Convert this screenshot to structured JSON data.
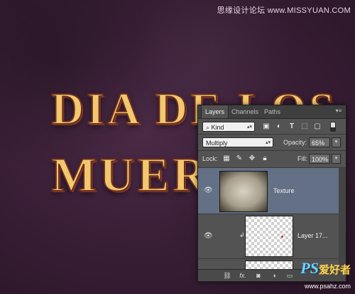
{
  "watermark_top": "思缘设计论坛 www.MISSYUAN.COM",
  "artwork": {
    "line1": "DIA DE LOS",
    "line2": "MUER"
  },
  "panel": {
    "tabs": [
      {
        "label": "Layers",
        "active": true
      },
      {
        "label": "Channels",
        "active": false
      },
      {
        "label": "Paths",
        "active": false
      }
    ],
    "filter": {
      "kind_label": "Kind"
    },
    "blend": {
      "mode": "Multiply",
      "opacity_label": "Opacity:",
      "opacity_value": "65%"
    },
    "lock": {
      "lock_label": "Lock:",
      "fill_label": "Fill:",
      "fill_value": "100%"
    },
    "layers": [
      {
        "name": "Texture",
        "selected": true,
        "visible": true
      },
      {
        "name": "Layer 17...",
        "selected": false,
        "visible": true,
        "clipped": true
      }
    ],
    "bottom_icons": [
      "link-icon",
      "fx-icon",
      "mask-icon",
      "adjustment-icon",
      "group-icon",
      "new-layer-icon",
      "trash-icon"
    ],
    "fx_label": "fx."
  },
  "watermark_bottom": {
    "ps": "PS",
    "cn": "爱好者",
    "url": "www.psahz.com"
  },
  "colors": {
    "selected_layer": "#637086",
    "panel_bg": "#535353",
    "text_art": "#f1c86e"
  }
}
